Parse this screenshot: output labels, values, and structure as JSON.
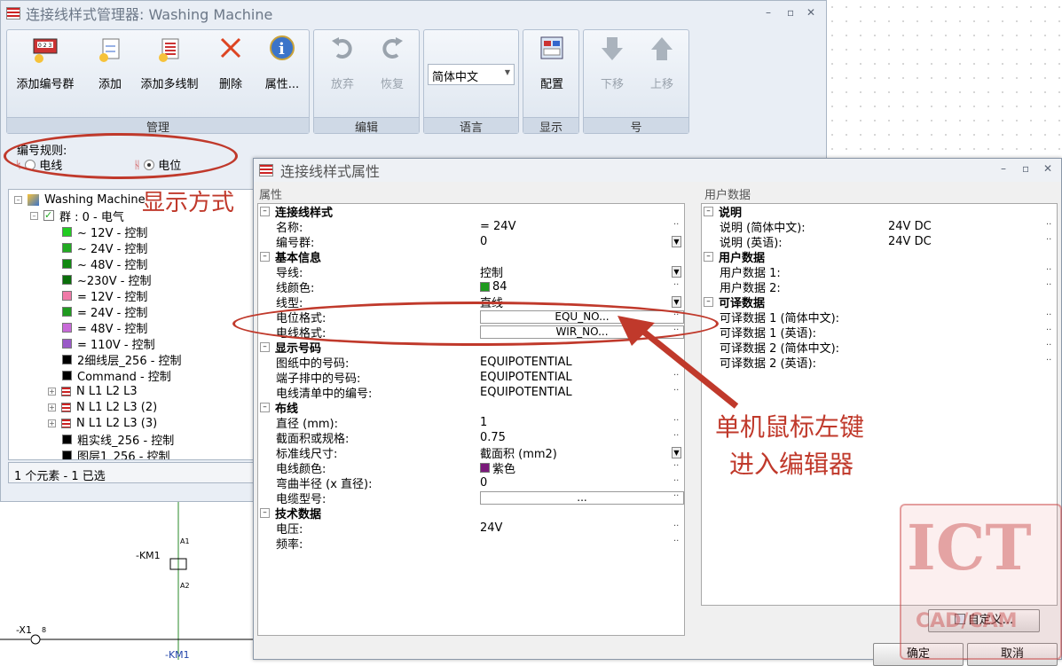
{
  "main_window": {
    "title": "连接线样式管理器: Washing Machine"
  },
  "ribbon": {
    "groups": [
      {
        "label": "管理",
        "buttons": [
          "添加编号群",
          "添加",
          "添加多线制",
          "删除",
          "属性..."
        ]
      },
      {
        "label": "编辑",
        "buttons": [
          "放弃",
          "恢复"
        ]
      },
      {
        "label": "语言",
        "dropdown": "简体中文"
      },
      {
        "label": "显示",
        "buttons": [
          "配置"
        ]
      },
      {
        "label": "号",
        "buttons": [
          "下移",
          "上移"
        ]
      }
    ]
  },
  "numbering_rule": {
    "label": "编号规则:",
    "option_wire": "电线",
    "option_potential": "电位",
    "selected": "电位"
  },
  "tree": {
    "root": "Washing Machine",
    "group": "群 : 0 - 电气",
    "items": [
      {
        "label": "~ 12V - 控制",
        "color": "#22cc22"
      },
      {
        "label": "~ 24V - 控制",
        "color": "#22aa22"
      },
      {
        "label": "~ 48V - 控制",
        "color": "#118811"
      },
      {
        "label": "~230V - 控制",
        "color": "#0a6e0a"
      },
      {
        "label": "= 12V - 控制",
        "color": "#f07aa8"
      },
      {
        "label": "= 24V - 控制",
        "color": "#1f9a1f"
      },
      {
        "label": "= 48V - 控制",
        "color": "#c86ad8"
      },
      {
        "label": "= 110V - 控制",
        "color": "#9a5ac8"
      },
      {
        "label": "2细线层_256 - 控制",
        "color": "#000000"
      },
      {
        "label": "Command - 控制",
        "color": "#000000"
      },
      {
        "label": "N L1 L2 L3",
        "color": "#cc2222",
        "expand": true
      },
      {
        "label": "N L1 L2 L3 (2)",
        "color": "#cc2222",
        "expand": true
      },
      {
        "label": "N L1 L2 L3 (3)",
        "color": "#cc2222",
        "expand": true
      },
      {
        "label": "粗实线_256 - 控制",
        "color": "#000000"
      },
      {
        "label": "图层1_256 - 控制",
        "color": "#000000"
      }
    ]
  },
  "status": "1 个元素 - 1 已选",
  "canvas": {
    "km1_label": "-KM1",
    "a1": "A1",
    "a2": "A2",
    "x1": "-X1",
    "x1_pin": "8",
    "km1_bottom": "-KM1"
  },
  "dialog": {
    "title": "连接线样式属性",
    "props_label": "属性",
    "user_label": "用户数据",
    "sections": [
      {
        "title": "连接线样式",
        "rows": [
          [
            "名称:",
            "= 24V"
          ],
          [
            "编号群:",
            "0"
          ]
        ]
      },
      {
        "title": "基本信息",
        "rows": [
          [
            "导线:",
            "控制"
          ],
          [
            "线颜色:",
            "84"
          ],
          [
            "线型:",
            "直线"
          ],
          [
            "电位格式:",
            "EQU_NO..."
          ],
          [
            "电线格式:",
            "WIR_NO..."
          ]
        ]
      },
      {
        "title": "显示号码",
        "rows": [
          [
            "图纸中的号码:",
            "EQUIPOTENTIAL"
          ],
          [
            "端子排中的号码:",
            "EQUIPOTENTIAL"
          ],
          [
            "电线清单中的编号:",
            "EQUIPOTENTIAL"
          ]
        ]
      },
      {
        "title": "布线",
        "rows": [
          [
            "直径 (mm):",
            "1"
          ],
          [
            "截面积或规格:",
            "0.75"
          ],
          [
            "标准线尺寸:",
            "截面积 (mm2)"
          ],
          [
            "电线颜色:",
            "紫色"
          ],
          [
            "弯曲半径 (x 直径):",
            "0"
          ],
          [
            "电缆型号:",
            "..."
          ]
        ]
      },
      {
        "title": "技术数据",
        "rows": [
          [
            "电压:",
            "24V"
          ],
          [
            "频率:",
            ""
          ]
        ]
      }
    ],
    "user_sections": [
      {
        "title": "说明",
        "rows": [
          [
            "说明 (简体中文):",
            "24V DC"
          ],
          [
            "说明 (英语):",
            "24V DC"
          ]
        ]
      },
      {
        "title": "用户数据",
        "rows": [
          [
            "用户数据 1:",
            ""
          ],
          [
            "用户数据 2:",
            ""
          ]
        ]
      },
      {
        "title": "可译数据",
        "rows": [
          [
            "可译数据 1 (简体中文):",
            ""
          ],
          [
            "可译数据 1 (英语):",
            ""
          ],
          [
            "可译数据 2 (简体中文):",
            ""
          ],
          [
            "可译数据 2 (英语):",
            ""
          ]
        ]
      }
    ],
    "custom_button": "自定义...",
    "ok": "确定",
    "cancel": "取消"
  },
  "annotations": {
    "display_mode": "显示方式",
    "click_line1": "单机鼠标左键",
    "click_line2": "进入编辑器"
  },
  "watermark": {
    "big": "ICT",
    "small": "CAD/CAM"
  },
  "colors": {
    "annot": "#c0392b",
    "line_color_swatch": "#1f9a1f",
    "wire_color_swatch": "#7a1a7a"
  }
}
